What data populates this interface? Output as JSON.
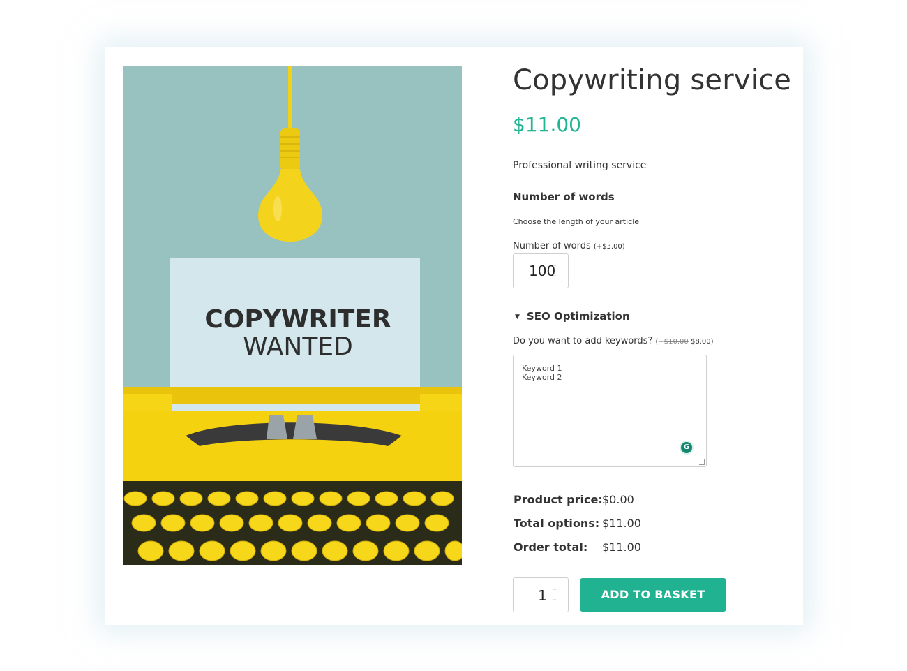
{
  "product": {
    "title": "Copywriting service",
    "price": "$11.00",
    "description": "Professional writing service",
    "image": {
      "sign_line1": "COPYWRITER",
      "sign_line2": "WANTED"
    }
  },
  "words_section": {
    "heading": "Number of words",
    "subheading": "Choose the length of your article",
    "field_label": "Number of words",
    "field_price": "(+$3.00)",
    "value": "100"
  },
  "seo_section": {
    "heading": "SEO Optimization",
    "field_label": "Do you want to add keywords?",
    "price_prefix": "(+",
    "price_old": "$10.00",
    "price_new": "$8.00)",
    "keywords": [
      "Keyword 1",
      "Keyword 2"
    ],
    "grammarly_letter": "G"
  },
  "totals": {
    "product_price_label": "Product price:",
    "product_price": "$0.00",
    "options_label": "Total options:",
    "options": "$11.00",
    "order_label": "Order total:",
    "order": "$11.00"
  },
  "cart": {
    "quantity": "1",
    "button_label": "ADD TO BASKET"
  },
  "colors": {
    "accent": "#20b291",
    "price": "#21b593",
    "image_background": "#98c2bf",
    "typewriter_yellow": "#f5d20f"
  }
}
